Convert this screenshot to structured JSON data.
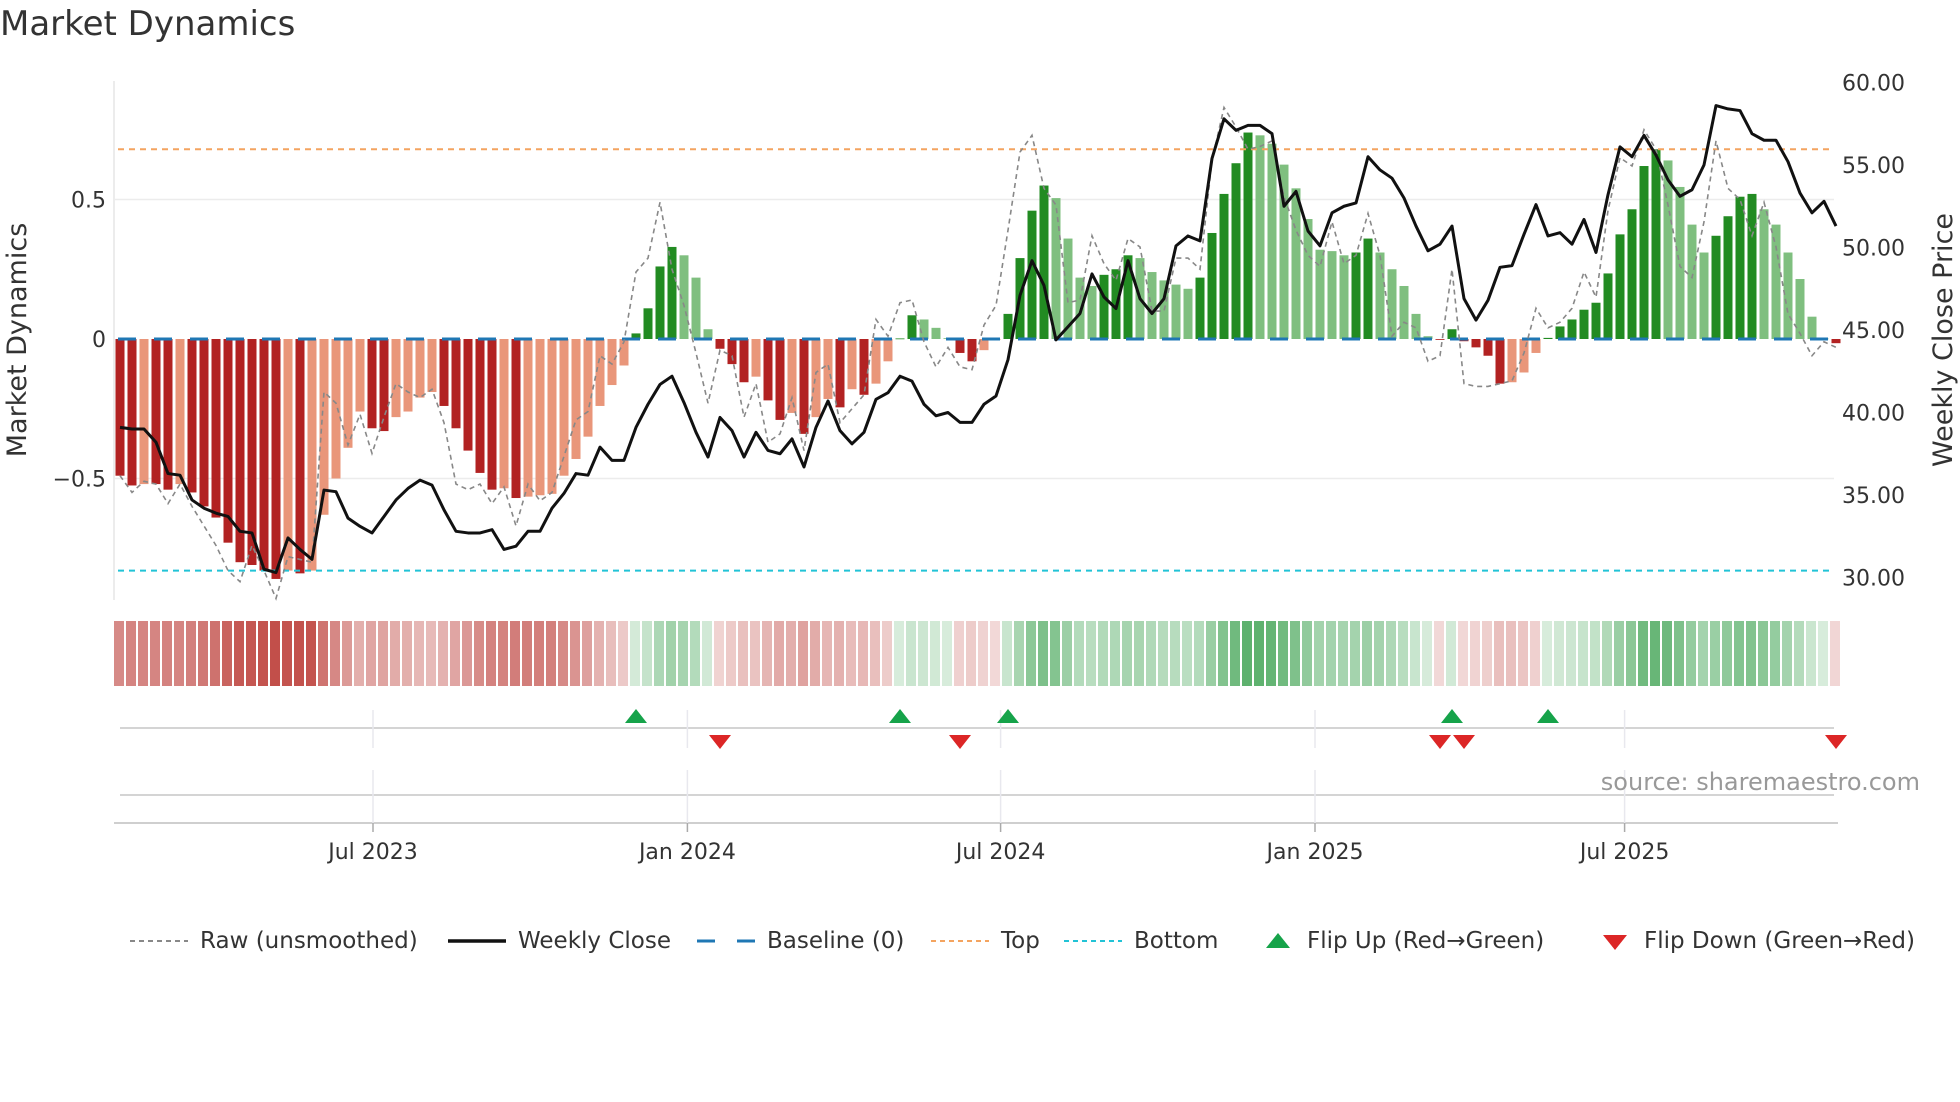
{
  "title": "Market Dynamics",
  "source": "source: sharemaestro.com",
  "chart_data": {
    "type": "bar",
    "title": "Market Dynamics",
    "ylabel": "Market Dynamics",
    "y2label": "Weekly Close Price",
    "ylim": [
      -0.95,
      0.93
    ],
    "y2lim": [
      28.6,
      62.9
    ],
    "yticks": [
      {
        "value": 0.5,
        "label": "0.5"
      },
      {
        "value": 0,
        "label": "0"
      },
      {
        "value": -0.5,
        "label": "−0.5"
      }
    ],
    "y2ticks": [
      {
        "value": 60,
        "label": "60.00"
      },
      {
        "value": 55,
        "label": "55.00"
      },
      {
        "value": 50,
        "label": "50.00"
      },
      {
        "value": 45,
        "label": "45.00"
      },
      {
        "value": 40,
        "label": "40.00"
      },
      {
        "value": 35,
        "label": "35.00"
      },
      {
        "value": 30,
        "label": "30.00"
      }
    ],
    "xticks": [
      {
        "week": 21.5,
        "label": "Jul 2023"
      },
      {
        "week": 47.7,
        "label": "Jan 2024"
      },
      {
        "week": 73.8,
        "label": "Jul 2024"
      },
      {
        "week": 100,
        "label": "Jan 2025"
      },
      {
        "week": 125.8,
        "label": "Jul 2025"
      }
    ],
    "top_level": 0.68,
    "bottom_level": -0.83,
    "baseline": 0,
    "grid": true,
    "legend_position": "bottom",
    "colors": {
      "dark_red": "#b22222",
      "light_red": "#e9967a",
      "dark_green": "#228b22",
      "light_green": "#7fbf7f",
      "raw": "#888888",
      "close": "#111111",
      "baseline": "#1f77b4",
      "top": "#f4a460",
      "bottom": "#22c3d6",
      "flip_up": "#16a34a",
      "flip_down": "#dc2626"
    },
    "legend": [
      {
        "key": "raw",
        "label": "Raw (unsmoothed)"
      },
      {
        "key": "close",
        "label": "Weekly Close"
      },
      {
        "key": "baseline",
        "label": "Baseline (0)"
      },
      {
        "key": "top",
        "label": "Top"
      },
      {
        "key": "bottom",
        "label": "Bottom"
      },
      {
        "key": "flip_up",
        "label": "Flip Up (Red→Green)"
      },
      {
        "key": "flip_down",
        "label": "Flip Down (Green→Red)"
      }
    ],
    "series": [
      {
        "name": "Market Dynamics (smoothed)",
        "values": [
          -0.49,
          -0.525,
          -0.52,
          -0.52,
          -0.54,
          -0.52,
          -0.55,
          -0.6,
          -0.64,
          -0.73,
          -0.8,
          -0.81,
          -0.83,
          -0.86,
          -0.83,
          -0.84,
          -0.83,
          -0.63,
          -0.5,
          -0.39,
          -0.26,
          -0.32,
          -0.33,
          -0.28,
          -0.26,
          -0.21,
          -0.19,
          -0.24,
          -0.32,
          -0.4,
          -0.48,
          -0.54,
          -0.535,
          -0.57,
          -0.565,
          -0.56,
          -0.555,
          -0.49,
          -0.43,
          -0.35,
          -0.24,
          -0.165,
          -0.095,
          0.02,
          0.11,
          0.26,
          0.33,
          0.3,
          0.22,
          0.035,
          -0.035,
          -0.09,
          -0.155,
          -0.135,
          -0.22,
          -0.29,
          -0.265,
          -0.34,
          -0.28,
          -0.215,
          -0.245,
          -0.18,
          -0.2,
          -0.16,
          -0.08,
          0.002,
          0.085,
          0.07,
          0.04,
          0.003,
          -0.05,
          -0.08,
          -0.04,
          -0.001,
          0.09,
          0.29,
          0.46,
          0.55,
          0.505,
          0.36,
          0.22,
          0.19,
          0.23,
          0.25,
          0.3,
          0.29,
          0.24,
          0.21,
          0.195,
          0.18,
          0.22,
          0.38,
          0.52,
          0.63,
          0.74,
          0.73,
          0.7,
          0.625,
          0.54,
          0.43,
          0.32,
          0.315,
          0.3,
          0.31,
          0.36,
          0.31,
          0.25,
          0.19,
          0.09,
          0.01,
          -0.003,
          0.035,
          -0.008,
          -0.03,
          -0.06,
          -0.16,
          -0.155,
          -0.12,
          -0.05,
          0.004,
          0.045,
          0.07,
          0.105,
          0.13,
          0.235,
          0.375,
          0.465,
          0.62,
          0.68,
          0.64,
          0.545,
          0.41,
          0.31,
          0.37,
          0.44,
          0.51,
          0.52,
          0.465,
          0.41,
          0.31,
          0.215,
          0.08,
          0.002,
          -0.015
        ]
      },
      {
        "name": "Raw (unsmoothed)",
        "values": [
          -0.49,
          -0.55,
          -0.51,
          -0.52,
          -0.59,
          -0.52,
          -0.6,
          -0.67,
          -0.74,
          -0.83,
          -0.87,
          -0.74,
          -0.83,
          -0.93,
          -0.78,
          -0.79,
          -0.8,
          -0.19,
          -0.23,
          -0.38,
          -0.27,
          -0.41,
          -0.28,
          -0.16,
          -0.19,
          -0.21,
          -0.18,
          -0.3,
          -0.52,
          -0.54,
          -0.52,
          -0.59,
          -0.53,
          -0.67,
          -0.52,
          -0.58,
          -0.55,
          -0.42,
          -0.29,
          -0.26,
          -0.06,
          -0.09,
          -0.01,
          0.24,
          0.29,
          0.49,
          0.25,
          0.12,
          -0.05,
          -0.23,
          -0.04,
          -0.06,
          -0.28,
          -0.16,
          -0.37,
          -0.34,
          -0.21,
          -0.4,
          -0.12,
          -0.09,
          -0.3,
          -0.25,
          -0.2,
          0.07,
          0.01,
          0.13,
          0.14,
          -0.01,
          -0.1,
          -0.03,
          -0.1,
          -0.11,
          0.05,
          0.12,
          0.39,
          0.67,
          0.73,
          0.54,
          0.48,
          0.13,
          0.14,
          0.37,
          0.27,
          0.21,
          0.36,
          0.33,
          0.1,
          0.1,
          0.29,
          0.29,
          0.25,
          0.64,
          0.83,
          0.76,
          0.68,
          0.69,
          0.71,
          0.51,
          0.39,
          0.3,
          0.26,
          0.42,
          0.27,
          0.3,
          0.45,
          0.3,
          0.01,
          0.06,
          0.04,
          -0.08,
          -0.06,
          0.25,
          -0.16,
          -0.17,
          -0.17,
          -0.16,
          -0.15,
          -0.05,
          0.11,
          0.04,
          0.06,
          0.11,
          0.24,
          0.15,
          0.46,
          0.65,
          0.62,
          0.75,
          0.68,
          0.48,
          0.26,
          0.22,
          0.42,
          0.71,
          0.54,
          0.5,
          0.37,
          0.49,
          0.33,
          0.09,
          0.02,
          -0.06,
          -0.01,
          -0.03
        ]
      },
      {
        "name": "Weekly Close",
        "axis": "right",
        "values": [
          39.1,
          39.0,
          39.0,
          38.2,
          36.3,
          36.2,
          34.7,
          34.2,
          33.9,
          33.7,
          32.8,
          32.7,
          30.5,
          30.3,
          32.4,
          31.7,
          31.1,
          35.3,
          35.2,
          33.6,
          33.1,
          32.7,
          33.7,
          34.7,
          35.4,
          35.9,
          35.6,
          34.1,
          32.8,
          32.7,
          32.7,
          32.9,
          31.7,
          31.9,
          32.8,
          32.8,
          34.2,
          35.1,
          36.3,
          36.2,
          37.9,
          37.1,
          37.1,
          39.1,
          40.5,
          41.7,
          42.2,
          40.6,
          38.8,
          37.3,
          39.7,
          38.9,
          37.3,
          38.8,
          37.7,
          37.5,
          38.4,
          36.7,
          39.1,
          40.7,
          38.9,
          38.1,
          38.8,
          40.8,
          41.2,
          42.2,
          41.9,
          40.5,
          39.8,
          40.0,
          39.4,
          39.4,
          40.5,
          41.0,
          43.2,
          47.1,
          49.2,
          47.7,
          44.4,
          45.2,
          46.0,
          48.4,
          47.0,
          46.3,
          49.2,
          46.9,
          46.0,
          46.9,
          50.1,
          50.7,
          50.4,
          55.4,
          57.8,
          57.1,
          57.4,
          57.4,
          56.9,
          52.5,
          53.4,
          51.0,
          50.1,
          52.1,
          52.5,
          52.7,
          55.5,
          54.7,
          54.2,
          53.0,
          51.3,
          49.8,
          50.2,
          51.3,
          46.9,
          45.6,
          46.8,
          48.8,
          48.9,
          50.8,
          52.6,
          50.7,
          50.9,
          50.2,
          51.7,
          49.7,
          53.2,
          56.1,
          55.5,
          56.8,
          55.6,
          54.1,
          53.1,
          53.5,
          55.0,
          58.6,
          58.4,
          58.3,
          56.9,
          56.5,
          56.5,
          55.2,
          53.3,
          52.1,
          52.8,
          51.3
        ]
      }
    ],
    "flips": {
      "up": [
        43,
        65,
        74,
        111,
        119
      ],
      "down": [
        50,
        70,
        110,
        112,
        143
      ]
    }
  }
}
